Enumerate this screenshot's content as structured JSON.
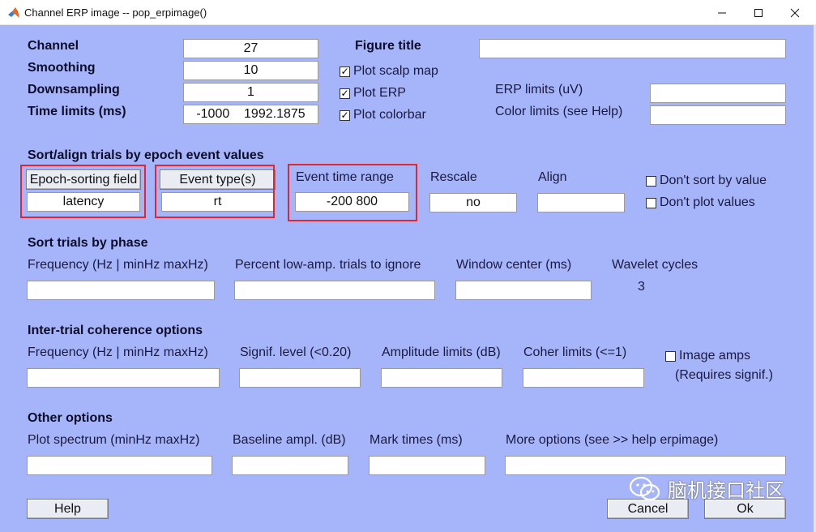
{
  "window": {
    "title": "Channel ERP image -- pop_erpimage()"
  },
  "fields": {
    "channel_label": "Channel",
    "channel_value": "27",
    "smoothing_label": "Smoothing",
    "smoothing_value": "10",
    "downsampling_label": "Downsampling",
    "downsampling_value": "1",
    "timelimits_label": "Time limits (ms)",
    "timelimits_value": "-1000    1992.1875",
    "figure_title_label": "Figure title",
    "figure_title_value": "",
    "erp_limits_label": "ERP limits (uV)",
    "erp_limits_value": "",
    "color_limits_label": "Color limits (see Help)",
    "color_limits_value": ""
  },
  "checkboxes": {
    "plot_scalp_map": {
      "label": "Plot scalp map",
      "checked": true,
      "mark": "✓"
    },
    "plot_erp": {
      "label": "Plot ERP",
      "checked": true,
      "mark": "✓"
    },
    "plot_colorbar": {
      "label": "Plot colorbar",
      "checked": true,
      "mark": "✓"
    },
    "dont_sort": {
      "label": "Don't sort by value",
      "checked": false
    },
    "dont_plot": {
      "label": "Don't plot values",
      "checked": false
    },
    "image_amps": {
      "label": "Image amps",
      "checked": false,
      "note": "(Requires signif.)"
    }
  },
  "sort_align": {
    "heading": "Sort/align trials by epoch event values",
    "epoch_field_button": "Epoch-sorting field",
    "epoch_field_value": "latency",
    "event_type_button": "Event type(s)",
    "event_type_value": "rt",
    "event_time_label": "Event time range",
    "event_time_value": "-200 800",
    "rescale_label": "Rescale",
    "rescale_value": "no",
    "align_label": "Align",
    "align_value": ""
  },
  "phase": {
    "heading": "Sort trials by phase",
    "freq_label": "Frequency (Hz | minHz maxHz)",
    "percent_label": "Percent low-amp. trials to ignore",
    "window_label": "Window center (ms)",
    "wavelet_label": "Wavelet cycles",
    "wavelet_value": "3"
  },
  "itc": {
    "heading": "Inter-trial coherence options",
    "freq_label": "Frequency (Hz | minHz maxHz)",
    "signif_label": "Signif. level (<0.20)",
    "amp_label": "Amplitude limits (dB)",
    "coher_label": "Coher limits (<=1)"
  },
  "other": {
    "heading": "Other options",
    "spectrum_label": "Plot spectrum (minHz maxHz)",
    "baseline_label": "Baseline ampl. (dB)",
    "mark_label": "Mark times (ms)",
    "more_label": "More options (see >> help erpimage)"
  },
  "buttons": {
    "help": "Help",
    "cancel": "Cancel",
    "ok": "Ok"
  },
  "watermark": {
    "text": "脑机接口社区",
    "icon": "wechat-icon"
  },
  "colors": {
    "panel": "#a6b5fa",
    "highlight": "#e0262e"
  }
}
